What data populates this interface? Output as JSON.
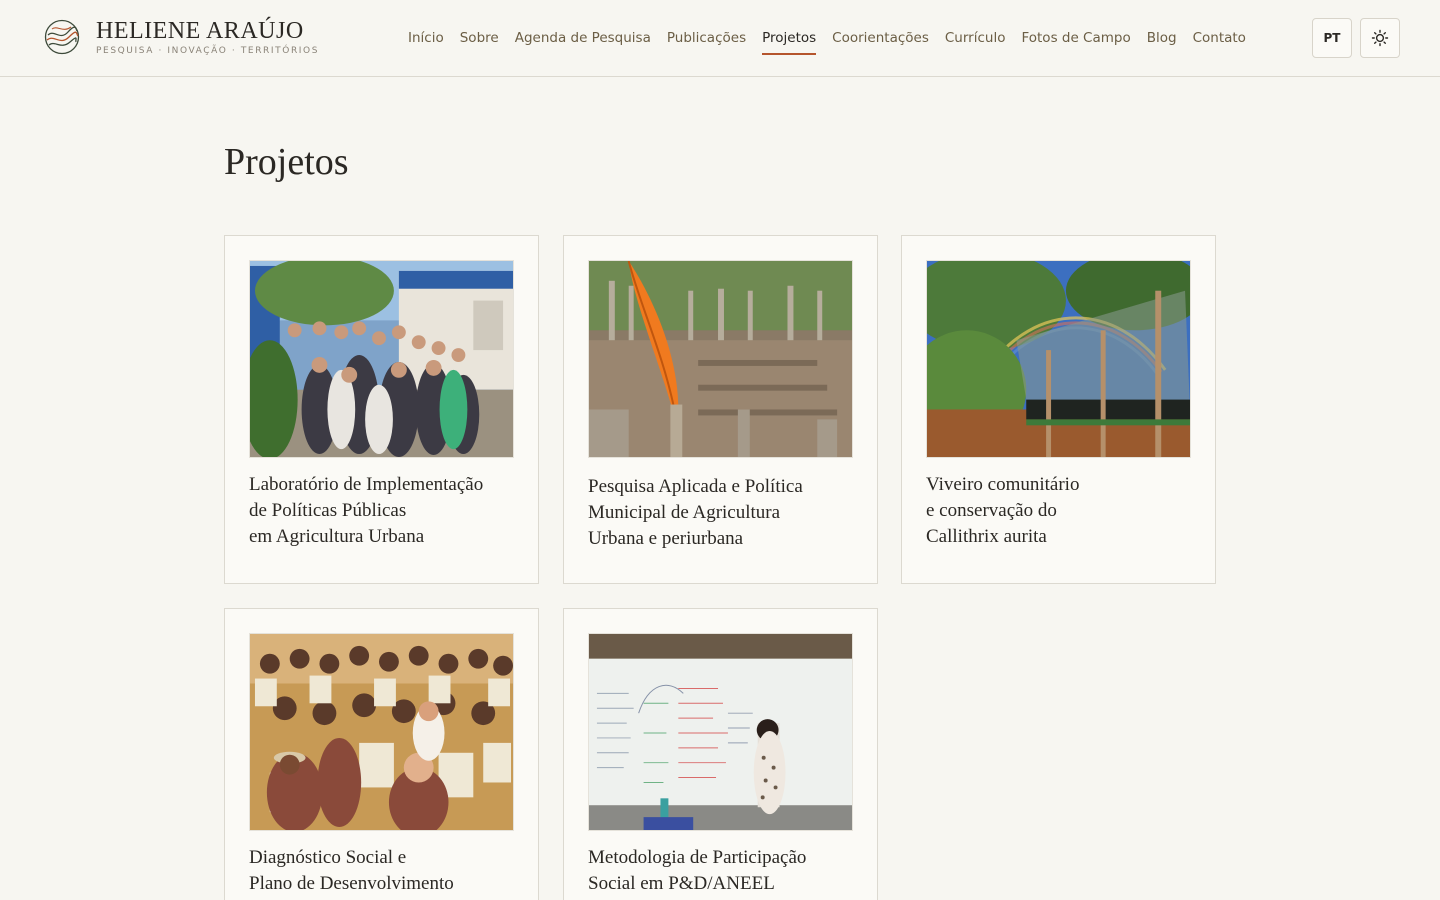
{
  "brand": {
    "name": "HELIENE ARAÚJO",
    "tagline": "PESQUISA · INOVAÇÃO · TERRITÓRIOS"
  },
  "nav": {
    "items": [
      {
        "label": "Início"
      },
      {
        "label": "Sobre"
      },
      {
        "label": "Agenda de Pesquisa"
      },
      {
        "label": "Publicações"
      },
      {
        "label": "Projetos"
      },
      {
        "label": "Coorientações"
      },
      {
        "label": "Currículo"
      },
      {
        "label": "Fotos de Campo"
      },
      {
        "label": "Blog"
      },
      {
        "label": "Contato"
      }
    ],
    "active": "Projetos"
  },
  "controls": {
    "language": "PT",
    "theme_icon": "sun-icon"
  },
  "page": {
    "title": "Projetos"
  },
  "projects": [
    {
      "title": "Laboratório de Implementação\nde Políticas Públicas\nem Agricultura Urbana",
      "image": "group-photo-outdoors"
    },
    {
      "title": "Pesquisa Aplicada e Política\nMunicipal de Agricultura\nUrbana e periurbana",
      "image": "orange-feather-garden"
    },
    {
      "title": "Viveiro comunitário\ne conservação do\nCallithrix aurita",
      "image": "nursery-rainbow"
    },
    {
      "title": "Diagnóstico Social e\nPlano de Desenvolvimento",
      "image": "crowd-holding-booklets"
    },
    {
      "title": "Metodologia de Participação\nSocial em P&D/ANEEL",
      "image": "whiteboard-presentation"
    }
  ],
  "colors": {
    "background": "#f7f6f1",
    "accent": "#b5552d",
    "nav_text": "#6b5e45"
  }
}
